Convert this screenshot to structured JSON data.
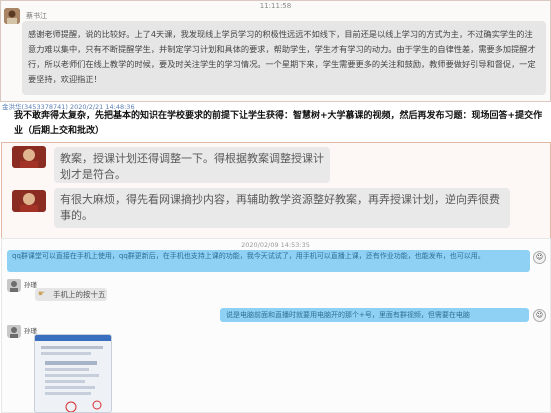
{
  "top_timestamp": "11:11:58",
  "msg1": {
    "sender": "蔡书江",
    "text": "感谢老师提醒，说的比较好。上了4天课，我发现线上学员学习的积极性远远不如线下，目前还是以线上学习的方式为主，不过确实学生的注意力难以集中，只有不断提醒学生，并制定学习计划和具体的要求，帮助学生，学生才有学习的动力。由于学生的自律性差，需要多加提醒才行，所以老师们在线上教学的时候，要及时关注学生的学习情况。一个星期下来，学生需要更多的关注和鼓励，教师要做好引导和督促，一定要坚持，欢迎指正！"
  },
  "msg2": {
    "sender": "金洪华(3453378741) 2020/2/21 14:48:36",
    "headline": "我不敢奔得太复杂，先把基本的知识在学校要求的前提下让学生获得：智慧树+大学慕课的视频，然后再发布习题：现场回答+提交作业（后期上交和批改）"
  },
  "msg3": {
    "bubble_a": "教案，授课计划还得调整一下。得根据教案调整授课计划才是符合。",
    "bubble_b": "有很大麻烦，得先看网课摘抄内容，再辅助教学资源整好教案，再弄授课计划，逆向弄很费事的。"
  },
  "chat": {
    "timestamp": "2020/02/09 14:53:35",
    "blue_msg_1": "qq群课堂可以直接在手机上使用，qq群更新后，在手机也支持上课的功能，我今天试试了，用手机可以直播上课，还有作业功能，也能发布，也可以用。",
    "user_a": "孙瑾",
    "user_a_msg": "手机上的按十五",
    "blue_msg_2": "说是电脑前面和直播时就要用电脑开的那个+号，里面有群视频，但需要在电脑",
    "user_b": "孙瑾"
  },
  "icons": [
    "emoji-icon",
    "avatar"
  ]
}
